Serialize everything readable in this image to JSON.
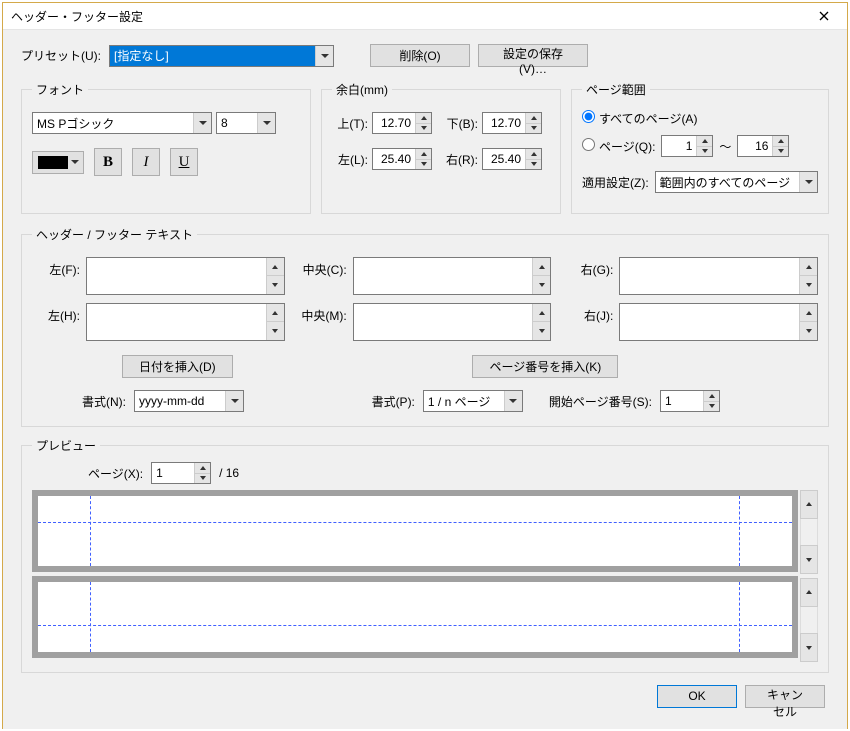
{
  "title": "ヘッダー・フッター設定",
  "preset": {
    "label": "プリセット(U):",
    "value": "[指定なし]",
    "delete": "削除(O)",
    "save": "設定の保存(V)…"
  },
  "font": {
    "legend": "フォント",
    "name": "MS Pゴシック",
    "size": "8",
    "color": "#000000",
    "bold": "B",
    "italic": "I",
    "underline": "U"
  },
  "margin": {
    "legend": "余白(mm)",
    "topLabel": "上(T):",
    "top": "12.70",
    "bottomLabel": "下(B):",
    "bottom": "12.70",
    "leftLabel": "左(L):",
    "left": "25.40",
    "rightLabel": "右(R):",
    "right": "25.40"
  },
  "range": {
    "legend": "ページ範囲",
    "allPages": "すべてのページ(A)",
    "pagesLabel": "ページ(Q):",
    "from": "1",
    "sep": "～",
    "to": "16",
    "applyLabel": "適用設定(Z):",
    "applyValue": "範囲内のすべてのページ"
  },
  "hf": {
    "legend": "ヘッダー / フッター テキスト",
    "hLeftLabel": "左(F):",
    "hCenterLabel": "中央(C):",
    "hRightLabel": "右(G):",
    "fLeftLabel": "左(H):",
    "fCenterLabel": "中央(M):",
    "fRightLabel": "右(J):",
    "insertDate": "日付を挿入(D)",
    "insertPage": "ページ番号を挿入(K)",
    "dateFmtLabel": "書式(N):",
    "dateFmt": "yyyy-mm-dd",
    "pageFmtLabel": "書式(P):",
    "pageFmt": "1 / n ページ",
    "startLabel": "開始ページ番号(S):",
    "start": "1"
  },
  "preview": {
    "legend": "プレビュー",
    "pageLabel": "ページ(X):",
    "page": "1",
    "total": "/  16"
  },
  "footer": {
    "ok": "OK",
    "cancel": "キャンセル"
  }
}
